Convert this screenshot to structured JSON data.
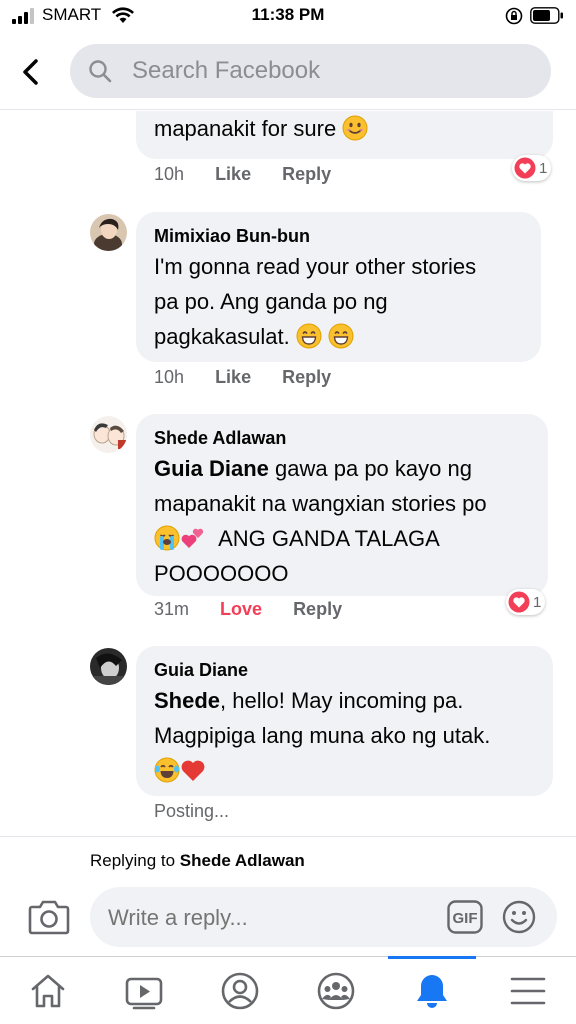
{
  "status_bar": {
    "carrier": "SMART",
    "time": "11:38 PM"
  },
  "header": {
    "search_placeholder": "Search Facebook"
  },
  "comments": [
    {
      "text": "mapanakit for sure",
      "time": "10h",
      "like_label": "Like",
      "reply_label": "Reply",
      "reaction_count": "1"
    },
    {
      "author": "Mimixiao Bun-bun",
      "line1": "I'm gonna read your other stories",
      "line2": "pa po. Ang ganda po ng",
      "line3": "pagkakasulat.",
      "time": "10h",
      "like_label": "Like",
      "reply_label": "Reply"
    },
    {
      "author": "Shede Adlawan",
      "mention": "Guia Diane",
      "line1_rest": " gawa pa po kayo ng",
      "line2": "mapanakit na wangxian stories po",
      "line3": "ANG GANDA TALAGA",
      "line4": "POOOOOOO",
      "time": "31m",
      "like_label": "Love",
      "reply_label": "Reply",
      "reaction_count": "1"
    },
    {
      "author": "Guia Diane",
      "mention": "Shede",
      "line1_rest": ", hello! May incoming pa.",
      "line2": "Magpipiga lang muna ako ng utak.",
      "status": "Posting..."
    }
  ],
  "reply_bar": {
    "replying_prefix": "Replying to ",
    "replying_to": "Shede Adlawan",
    "input_placeholder": "Write a reply...",
    "gif_label": "GIF"
  },
  "colors": {
    "accent": "#1877f2",
    "love": "#f33e58",
    "bubble": "#f0f2f5",
    "search_bg": "#e4e6eb"
  },
  "icons": {
    "nav": [
      "home-icon",
      "watch-icon",
      "profile-icon",
      "groups-icon",
      "notifications-icon",
      "menu-icon"
    ],
    "active_nav": "notifications-icon"
  }
}
